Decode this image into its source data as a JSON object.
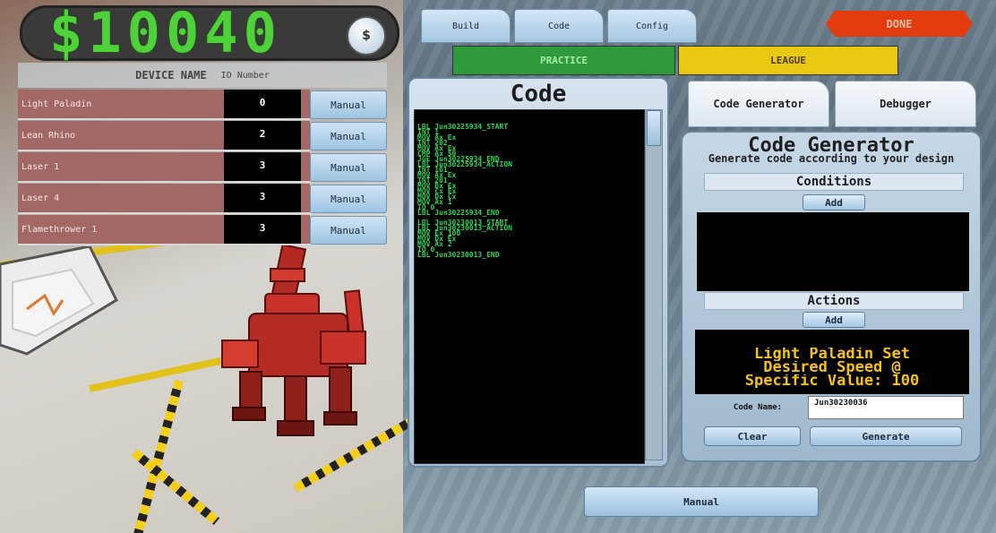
{
  "money": {
    "amount": "$10040",
    "coin_label": "$"
  },
  "device_table": {
    "header_name": "DEVICE NAME",
    "header_number": "IO Number",
    "rows": [
      {
        "name": "Light Paladin",
        "number": "0",
        "button": "Manual"
      },
      {
        "name": "Lean Rhino",
        "number": "2",
        "button": "Manual"
      },
      {
        "name": "Laser 1",
        "number": "3",
        "button": "Manual"
      },
      {
        "name": "Laser 4",
        "number": "3",
        "button": "Manual"
      },
      {
        "name": "Flamethrower 1",
        "number": "3",
        "button": "Manual"
      }
    ]
  },
  "tabs": {
    "build": "Build",
    "code": "Code",
    "config": "Config"
  },
  "done": "DONE",
  "modes": {
    "practice": "PRACTICE",
    "league": "LEAGUE"
  },
  "code_panel": {
    "title": "Code",
    "lines": [
      "LBL Jun30225934_START",
      "INT 1",
      "MOV Ax Ex",
      "INT 202",
      "MOV Ax Ex",
      "CMP Ax 50",
      "JGE Jun30225934_END",
      "LBL Jun30225934_ACTION",
      "INT 101",
      "MOV Ax Ex",
      "INT 201",
      "MOV Bx Ex",
      "MOV Cx Ex",
      "MOV Dx Cx",
      "MOV Ax 1",
      "IO 0",
      "LBL Jun30225934_END",
      "",
      "LBL Jun30230013_START",
      "LBL Jun30230013_ACTION",
      "MOV Ex 100",
      "MOV Dx Ex",
      "MOV Ax 2",
      "IO 0",
      "LBL Jun30230013_END"
    ]
  },
  "side_tabs": {
    "generator": "Code Generator",
    "debugger": "Debugger"
  },
  "generator": {
    "title": "Code Generator",
    "subtitle": "Generate code according to your design",
    "conditions_label": "Conditions",
    "actions_label": "Actions",
    "add_label": "Add",
    "action_text_lines": [
      "Light Paladin Set",
      "Desired Speed @",
      "Specific Value:  100"
    ],
    "code_name_label": "Code Name:",
    "code_name_value": "Jun30230036",
    "clear_label": "Clear",
    "generate_label": "Generate"
  },
  "manual_button": "Manual",
  "colors": {
    "money_green": "#4fd13a",
    "done_red": "#e23c0e",
    "practice_green": "#2f9a3c",
    "league_yellow": "#e9c814",
    "code_green": "#2ad45a",
    "action_yellow": "#f4c414",
    "device_row": "#a26866"
  },
  "icons": {
    "coin": "dollar-coin-icon"
  }
}
